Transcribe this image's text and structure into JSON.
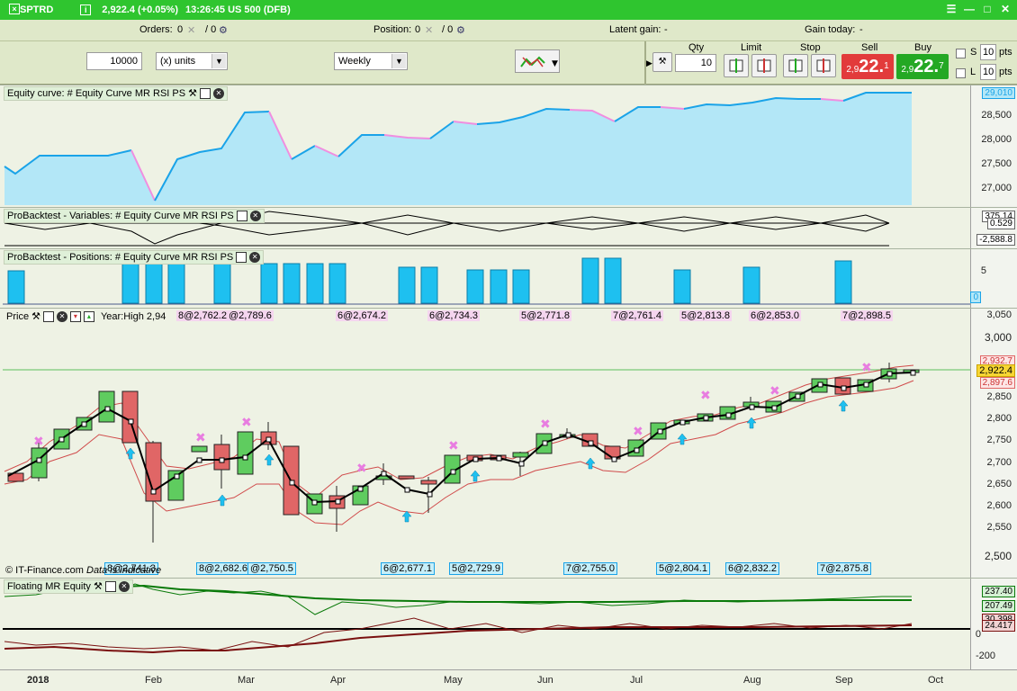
{
  "titlebar": {
    "symbol": "SPTRD",
    "price": "2,922.4 (+0.05%)",
    "time_market": "13:26:45  US 500 (DFB)"
  },
  "orders_bar": {
    "orders_label": "Orders:",
    "orders_value": "0",
    "orders_sep": "/ 0",
    "position_label": "Position:",
    "position_value": "0",
    "position_sep": "/ 0",
    "latent_label": "Latent gain:",
    "latent_value": "-",
    "today_label": "Gain today:",
    "today_value": "-"
  },
  "controls": {
    "quantity": "10000",
    "units": "(x) units",
    "timeframe": "Weekly",
    "qty_label": "Qty",
    "qty_value": "10",
    "limit_label": "Limit",
    "stop_label": "Stop",
    "sell_label": "Sell",
    "sell_prefix": "2,9",
    "sell_big": "22.",
    "sell_sup": "1",
    "buy_label": "Buy",
    "buy_prefix": "2,9",
    "buy_big": "22.",
    "buy_sup": "7",
    "s_label": "S",
    "s_value": "10",
    "l_label": "L",
    "l_value": "10",
    "pts": "pts"
  },
  "panels": {
    "equity": {
      "title": "Equity curve: # Equity Curve MR RSI PS",
      "ylabels": [
        "28,500",
        "28,000",
        "27,500",
        "27,000"
      ],
      "tag": "29,010"
    },
    "variables": {
      "title": "ProBacktest - Variables: # Equity Curve MR RSI PS",
      "tags": [
        "375.14",
        "0.529",
        "-2,588.8"
      ]
    },
    "positions": {
      "title": "ProBacktest - Positions: # Equity Curve MR RSI PS",
      "ylabels": [
        "5"
      ],
      "tag": "0"
    },
    "price": {
      "title": "Price",
      "info": "Year:High 2,94",
      "ylabels": [
        "3,050",
        "3,000",
        "2,950",
        "2,900",
        "2,850",
        "2,800",
        "2,750",
        "2,700",
        "2,650",
        "2,600",
        "2,550",
        "2,500"
      ],
      "tags": [
        "2,932.7",
        "2,922.4",
        "2,897.6"
      ],
      "top_orders": [
        "8@2,762.2",
        "@2,789.6",
        "6@2,674.2",
        "6@2,734.3",
        "5@2,771.8",
        "7@2,761.4",
        "5@2,813.8",
        "6@2,853.0",
        "7@2,898.5"
      ],
      "bottom_orders": [
        "8@2,741.3",
        "8@2,682.6",
        "@2,750.5",
        "6@2,677.1",
        "5@2,729.9",
        "7@2,755.0",
        "5@2,804.1",
        "6@2,832.2",
        "7@2,875.8"
      ],
      "copyright": "© IT-Finance.com",
      "data_note": "Data is indicative"
    },
    "floating": {
      "title": "Floating MR Equity",
      "ylabels": [
        "0",
        "-200"
      ],
      "tags": [
        "237.40",
        "207.49",
        "30.398",
        "24.417"
      ]
    }
  },
  "xaxis": [
    "2018",
    "Feb",
    "Mar",
    "Apr",
    "May",
    "Jun",
    "Jul",
    "Aug",
    "Sep",
    "Oct"
  ],
  "colors": {
    "title_green": "#2fc52f",
    "bull": "#5fcc5f",
    "bear": "#e06666",
    "equity_fill": "#b3e7f7",
    "equity_line": "#1aa3e8"
  }
}
